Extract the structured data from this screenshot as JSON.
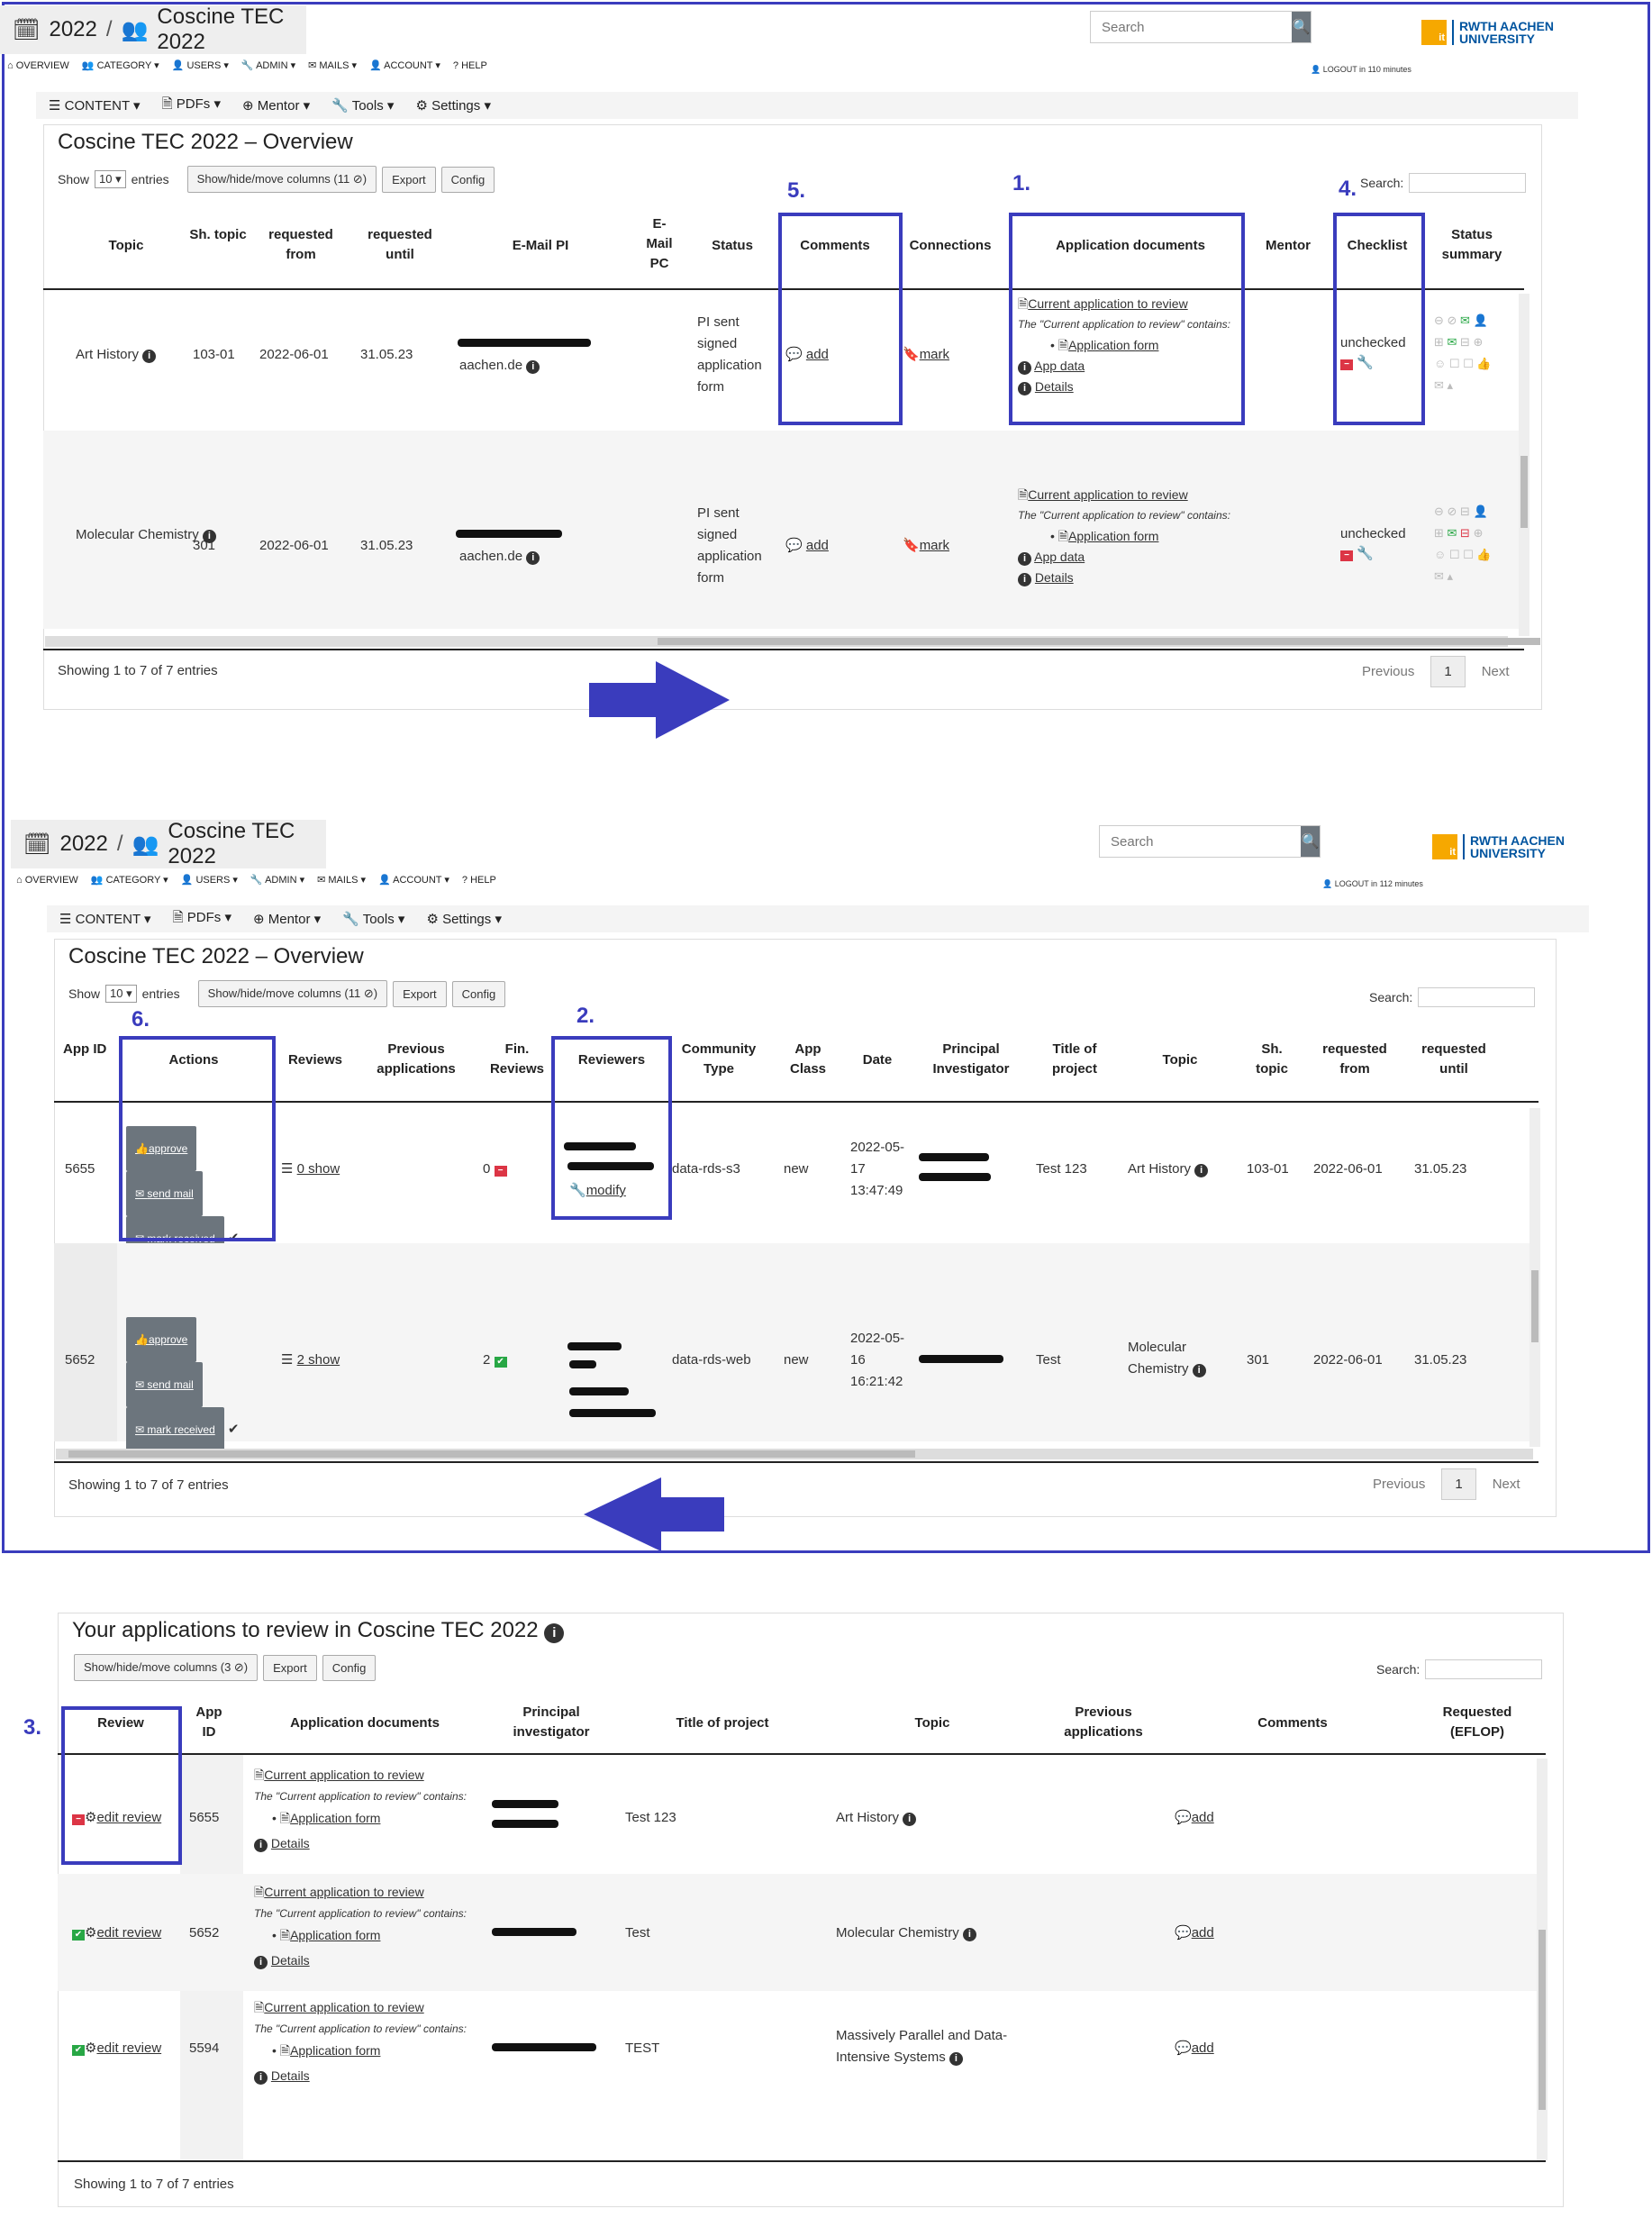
{
  "outer_frame_color": "#3a3cbd",
  "screen1": {
    "breadcrumb": {
      "year": "2022",
      "project": "Coscine TEC 2022"
    },
    "search_placeholder": "Search",
    "logo": {
      "it": "it",
      "it_sub": "Center",
      "rwth": "RWTH AACHEN",
      "univ": "UNIVERSITY"
    },
    "menu": [
      "OVERVIEW",
      "CATEGORY",
      "USERS",
      "ADMIN",
      "MAILS",
      "ACCOUNT",
      "HELP"
    ],
    "logout": "LOGOUT in 110 minutes",
    "submenu": [
      "CONTENT",
      "PDFs",
      "Mentor",
      "Tools",
      "Settings"
    ],
    "title": "Coscine TEC 2022 – Overview",
    "show": "Show",
    "entries_val": "10",
    "entries": "entries",
    "btn_columns": "Show/hide/move columns (11 ⊘)",
    "btn_export": "Export",
    "btn_config": "Config",
    "search_label": "Search:",
    "headers": [
      "Topic",
      "Sh. topic",
      "requested from",
      "requested until",
      "E-Mail PI",
      "E-Mail PC",
      "Status",
      "Comments",
      "Connections",
      "Application documents",
      "Mentor",
      "Checklist",
      "Status summary"
    ],
    "rows": [
      {
        "topic": "Art History",
        "sh": "103-01",
        "from": "2022-06-01",
        "until": "31.05.23",
        "email": "aachen.de",
        "status": "PI sent signed application form",
        "comment": "add",
        "conn": "mark",
        "doc1": "Current application to review",
        "doc_note": "The \"Current application to review\" contains:",
        "doc2": "Application form",
        "doc3": "App data",
        "doc4": "Details",
        "check": "unchecked"
      },
      {
        "topic": "Molecular Chemistry",
        "sh": "301",
        "from": "2022-06-01",
        "until": "31.05.23",
        "email": "aachen.de",
        "status": "PI sent signed application form",
        "comment": "add",
        "conn": "mark",
        "doc1": "Current application to review",
        "doc_note": "The \"Current application to review\" contains:",
        "doc2": "Application form",
        "doc3": "App data",
        "doc4": "Details",
        "check": "unchecked"
      }
    ],
    "showing": "Showing 1 to 7 of 7 entries",
    "prev": "Previous",
    "page": "1",
    "next": "Next",
    "labels": {
      "l1": "1.",
      "l4": "4.",
      "l5": "5."
    }
  },
  "screen2": {
    "breadcrumb": {
      "year": "2022",
      "project": "Coscine TEC 2022"
    },
    "search_placeholder": "Search",
    "logout": "LOGOUT in 112 minutes",
    "title": "Coscine TEC 2022 – Overview",
    "headers": [
      "App ID",
      "Actions",
      "Reviews",
      "Previous applications",
      "Fin. Reviews",
      "Reviewers",
      "Community Type",
      "App Class",
      "Date",
      "Principal Investigator",
      "Title of project",
      "Topic",
      "Sh. topic",
      "requested from",
      "requested until"
    ],
    "actions": {
      "approve": "approve",
      "send": "send mail",
      "mark": "mark received"
    },
    "rows": [
      {
        "id": "5655",
        "reviews": "0 show",
        "fin": "0",
        "modify": "modify",
        "ctype": "data-rds-s3",
        "cls": "new",
        "date": "2022-05-17 13:47:49",
        "title": "Test 123",
        "topic": "Art History",
        "sh": "103-01",
        "from": "2022-06-01",
        "until": "31.05.23"
      },
      {
        "id": "5652",
        "reviews": "2 show",
        "fin": "2",
        "modify": "",
        "ctype": "data-rds-web",
        "cls": "new",
        "date": "2022-05-16 16:21:42",
        "title": "Test",
        "topic": "Molecular Chemistry",
        "sh": "301",
        "from": "2022-06-01",
        "until": "31.05.23"
      }
    ],
    "showing": "Showing 1 to 7 of 7 entries",
    "labels": {
      "l2": "2.",
      "l6": "6."
    }
  },
  "screen3": {
    "title": "Your applications to review in Coscine TEC 2022",
    "btn_columns": "Show/hide/move columns (3 ⊘)",
    "btn_export": "Export",
    "btn_config": "Config",
    "search_label": "Search:",
    "headers": [
      "Review",
      "App ID",
      "Application documents",
      "Principal investigator",
      "Title of project",
      "Topic",
      "Previous applications",
      "Comments",
      "Requested (EFLOP)"
    ],
    "rows": [
      {
        "review": "edit review",
        "id": "5655",
        "title": "Test 123",
        "topic": "Art History",
        "comment": "add"
      },
      {
        "review": "edit review",
        "id": "5652",
        "title": "Test",
        "topic": "Molecular Chemistry",
        "comment": "add"
      },
      {
        "review": "edit review",
        "id": "5594",
        "title": "TEST",
        "topic": "Massively Parallel and Data-Intensive Systems",
        "comment": "add"
      }
    ],
    "doc1": "Current application to review",
    "doc_note": "The \"Current application to review\" contains:",
    "doc2": "Application form",
    "doc4": "Details",
    "showing": "Showing 1 to 7 of 7 entries",
    "labels": {
      "l3": "3."
    }
  }
}
